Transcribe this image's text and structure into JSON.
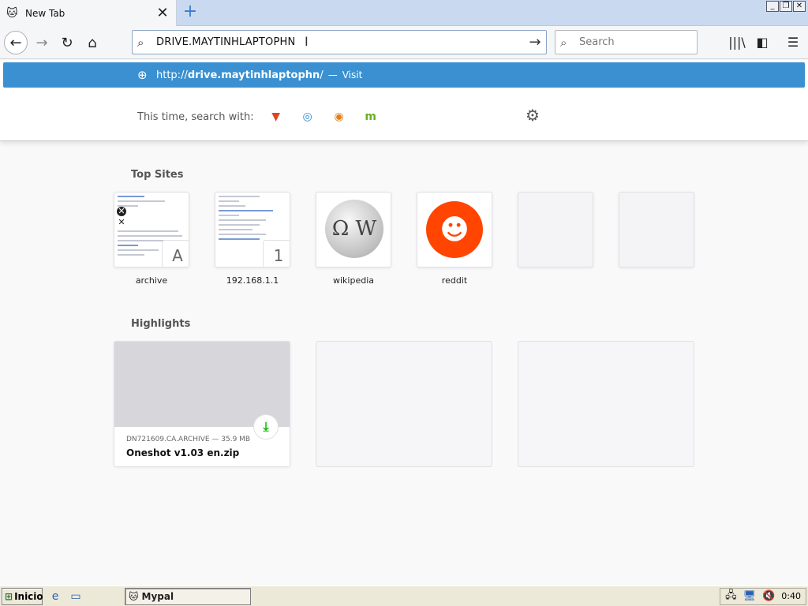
{
  "tab": {
    "title": "New Tab",
    "close": "✕",
    "favicon": "firefox-cat-icon"
  },
  "toolbar": {
    "url_value": "DRIVE.MAYTINHLAPTOPHN",
    "search_placeholder": "Search"
  },
  "suggestion": {
    "url_prefix": "http://",
    "url_bold": "drive.maytinhlaptophn",
    "url_suffix": "/",
    "separator": "—",
    "action": "Visit"
  },
  "oneoff": {
    "label": "This time, search with:"
  },
  "top_sites": {
    "title": "Top Sites",
    "items": [
      {
        "label": "archive",
        "badge": "A"
      },
      {
        "label": "192.168.1.1",
        "badge": "1"
      },
      {
        "label": "wikipedia"
      },
      {
        "label": "reddit"
      }
    ]
  },
  "wiki_glyph": "Ω W",
  "highlights": {
    "title": "Highlights",
    "card": {
      "meta": "DN721609.CA.ARCHIVE — 35.9 MB",
      "title": "Oneshot v1.03 en.zip"
    }
  },
  "taskbar": {
    "start_label": "Inicio",
    "task_label": "Mypal",
    "clock": "0:40"
  },
  "colors": {
    "accent": "#3a90d0",
    "reddit": "#ff4500",
    "download": "#12bc00"
  }
}
